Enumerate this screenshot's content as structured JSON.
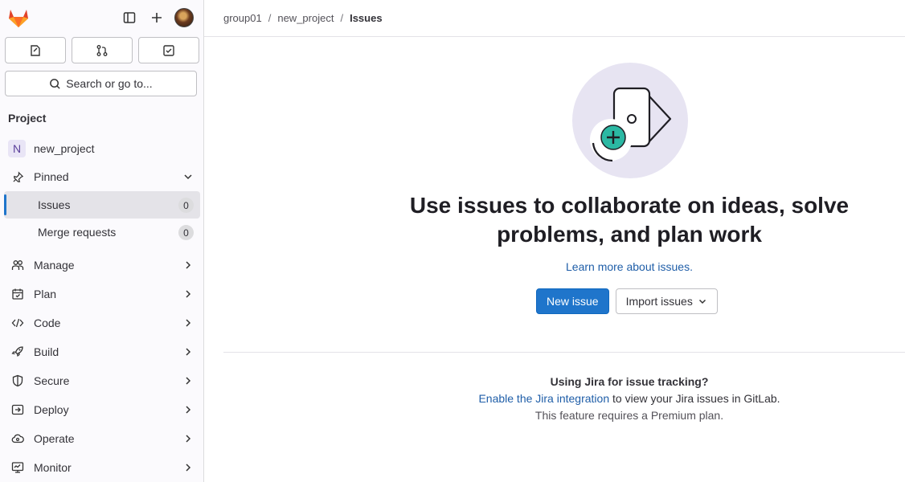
{
  "sidebar": {
    "quick_actions": [
      "issues-assigned",
      "merge-requests",
      "todos"
    ],
    "search_placeholder": "Search or go to...",
    "section_title": "Project",
    "project": {
      "initial": "N",
      "name": "new_project"
    },
    "pinned": {
      "label": "Pinned"
    },
    "pinned_items": [
      {
        "label": "Issues",
        "count": "0"
      },
      {
        "label": "Merge requests",
        "count": "0"
      }
    ],
    "menu": [
      {
        "label": "Manage",
        "icon": "users-icon"
      },
      {
        "label": "Plan",
        "icon": "calendar-icon"
      },
      {
        "label": "Code",
        "icon": "code-icon"
      },
      {
        "label": "Build",
        "icon": "rocket-icon"
      },
      {
        "label": "Secure",
        "icon": "shield-icon"
      },
      {
        "label": "Deploy",
        "icon": "deploy-icon"
      },
      {
        "label": "Operate",
        "icon": "cloud-icon"
      },
      {
        "label": "Monitor",
        "icon": "monitor-icon"
      }
    ]
  },
  "breadcrumb": [
    "group01",
    "new_project",
    "Issues"
  ],
  "empty_state": {
    "headline_1": "Use issues to collaborate on ideas, solve",
    "headline_2": "problems, and plan work",
    "learn_more": "Learn more about issues.",
    "new_issue": "New issue",
    "import_issues": "Import issues"
  },
  "jira": {
    "title": "Using Jira for issue tracking?",
    "link": "Enable the Jira integration",
    "rest": " to view your Jira issues in GitLab.",
    "note": "This feature requires a Premium plan."
  },
  "colors": {
    "primary": "#1f75cb",
    "link": "#1f5ea8",
    "illustration_bg": "#e7e4f2",
    "illustration_accent": "#2bb8a3"
  }
}
